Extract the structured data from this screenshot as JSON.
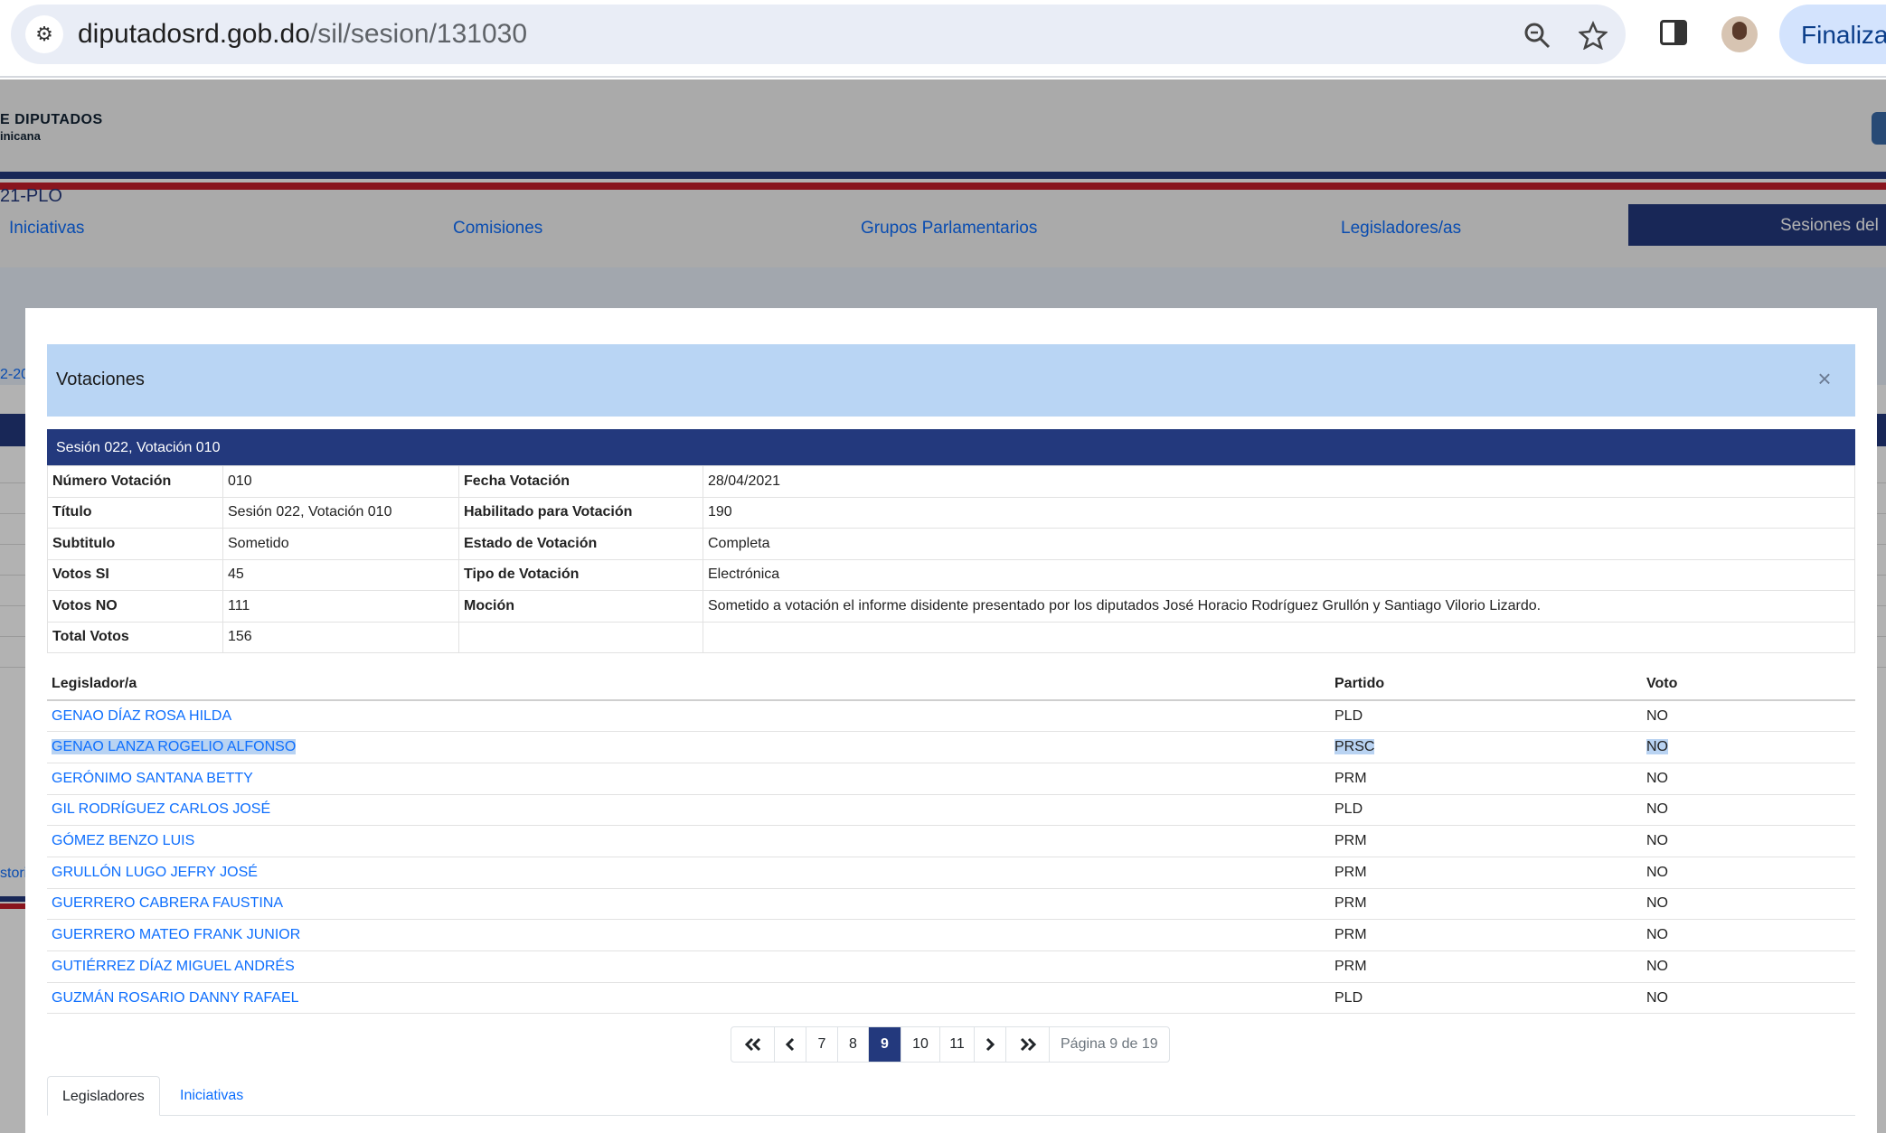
{
  "browser": {
    "url_domain": "diputadosrd.gob.do",
    "url_path": "/sil/sesion/131030",
    "finish_label": "Finaliza"
  },
  "background_page": {
    "logo_text": "E DIPUTADOS",
    "logo_sub": "inicana",
    "nav": [
      "Iniciativas",
      "Comisiones",
      "Grupos Parlamentarios",
      "Legisladores/as",
      "Sesiones del"
    ],
    "band_text": "21-PLO",
    "band_text2": "2-20",
    "side_text": "stori"
  },
  "modal": {
    "title": "Votaciones",
    "close_label": "×",
    "session_header": "Sesión 022, Votación 010",
    "details": [
      {
        "l1": "Número Votación",
        "v1": "010",
        "l2": "Fecha Votación",
        "v2": "28/04/2021"
      },
      {
        "l1": "Título",
        "v1": "Sesión 022, Votación 010",
        "l2": "Habilitado para Votación",
        "v2": "190"
      },
      {
        "l1": "Subtitulo",
        "v1": "Sometido",
        "l2": "Estado de Votación",
        "v2": "Completa"
      },
      {
        "l1": "Votos SI",
        "v1": "45",
        "l2": "Tipo de Votación",
        "v2": "Electrónica"
      },
      {
        "l1": "Votos NO",
        "v1": "111",
        "l2": "Moción",
        "v2": "Sometido a votación el informe disidente presentado por los diputados José Horacio Rodríguez Grullón y Santiago Vilorio Lizardo."
      },
      {
        "l1": "Total Votos",
        "v1": "156",
        "l2": "",
        "v2": ""
      }
    ],
    "legislators_table": {
      "headers": [
        "Legislador/a",
        "Partido",
        "Voto"
      ],
      "rows": [
        {
          "name": "GENAO DÍAZ ROSA HILDA",
          "party": "PLD",
          "vote": "NO"
        },
        {
          "name": "GENAO LANZA ROGELIO ALFONSO",
          "party": "PRSC",
          "vote": "NO"
        },
        {
          "name": "GERÓNIMO SANTANA BETTY",
          "party": "PRM",
          "vote": "NO"
        },
        {
          "name": "GIL RODRÍGUEZ CARLOS JOSÉ",
          "party": "PLD",
          "vote": "NO"
        },
        {
          "name": "GÓMEZ BENZO LUIS",
          "party": "PRM",
          "vote": "NO"
        },
        {
          "name": "GRULLÓN LUGO JEFRY JOSÉ",
          "party": "PRM",
          "vote": "NO"
        },
        {
          "name": "GUERRERO CABRERA FAUSTINA",
          "party": "PRM",
          "vote": "NO"
        },
        {
          "name": "GUERRERO MATEO FRANK JUNIOR",
          "party": "PRM",
          "vote": "NO"
        },
        {
          "name": "GUTIÉRREZ DÍAZ MIGUEL ANDRÉS",
          "party": "PRM",
          "vote": "NO"
        },
        {
          "name": "GUZMÁN ROSARIO DANNY RAFAEL",
          "party": "PLD",
          "vote": "NO"
        }
      ]
    },
    "pagination": {
      "pages": [
        "7",
        "8",
        "9",
        "10",
        "11"
      ],
      "current": "9",
      "info": "Página 9 de 19"
    },
    "tabs": [
      "Legisladores",
      "Iniciativas"
    ],
    "active_tab": "Legisladores"
  },
  "colors": {
    "navy": "#23397d",
    "link": "#0d6efd",
    "modal_header": "#b9d5f4",
    "selection": "#b9d3f2"
  }
}
